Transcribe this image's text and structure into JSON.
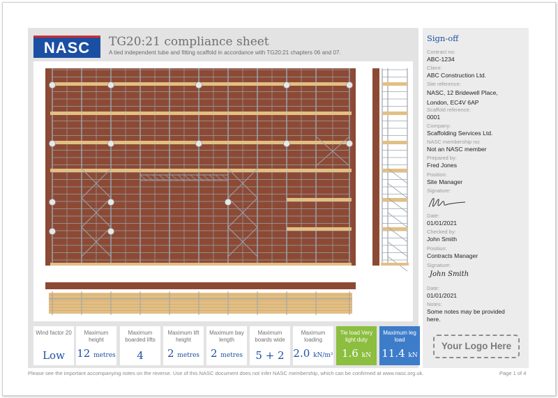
{
  "header": {
    "logo_text": "NASC",
    "title": "TG20:21 compliance sheet",
    "subtitle": "A tied independent tube and fitting scaffold in accordance with TG20:21 chapters 06 and 07."
  },
  "tiles": [
    {
      "label": "Wind factor 20",
      "value": "Low",
      "unit": "",
      "style": "green"
    },
    {
      "label": "Maximum height",
      "value": "12",
      "unit": "metres",
      "style": "white"
    },
    {
      "label": "Maximum boarded lifts",
      "value": "4",
      "unit": "",
      "style": "white"
    },
    {
      "label": "Maximum lift height",
      "value": "2",
      "unit": "metres",
      "style": "white"
    },
    {
      "label": "Maximum bay length",
      "value": "2",
      "unit": "metres",
      "style": "white"
    },
    {
      "label": "Maximum boards wide",
      "value": "5 + 2",
      "unit": "",
      "style": "white"
    },
    {
      "label": "Maximum loading",
      "value": "2.0",
      "unit": "kN/m²",
      "style": "white"
    },
    {
      "label": "Tie load Very light duty",
      "value": "1.6",
      "unit": "kN",
      "style": "green"
    },
    {
      "label": "Maximum leg load",
      "value": "11.4",
      "unit": "kN",
      "style": "blue"
    }
  ],
  "signoff": {
    "heading": "Sign-off",
    "contract_no_label": "Contract no:",
    "contract_no": "ABC-1234",
    "client_label": "Client:",
    "client": "ABC Construction Ltd.",
    "site_label": "Site reference:",
    "site_line1": "NASC, 12 Bridewell Place,",
    "site_line2": "London, EC4V 6AP",
    "scaffold_label": "Scaffold reference:",
    "scaffold": "0001",
    "company_label": "Company:",
    "company": "Scaffolding Services Ltd.",
    "membership_label": "NASC membership no:",
    "membership": "Not an NASC member",
    "prepared_label": "Prepared by:",
    "prepared": "Fred Jones",
    "position1_label": "Position:",
    "position1": "Site Manager",
    "signature1_label": "Signature:",
    "date1_label": "Date:",
    "date1": "01/01/2021",
    "checked_label": "Checked by:",
    "checked": "John Smith",
    "position2_label": "Position:",
    "position2": "Contracts Manager",
    "signature2_label": "Signature:",
    "signature2_text": "John Smith",
    "date2_label": "Date:",
    "date2": "01/01/2021",
    "notes_label": "Notes:",
    "notes_line1": "Some notes may be provided",
    "notes_line2": "here.",
    "your_logo": "Your Logo Here"
  },
  "footer": {
    "note": "Please see the important accompanying notes on the reverse. Use of this NASC document does not infer NASC membership, which can be confirmed at www.nasc.org.uk.",
    "page": "Page 1 of 4"
  },
  "colors": {
    "brand_blue": "#1b4fa3",
    "brand_red": "#d22c2c",
    "brick": "#8c4a35",
    "board": "#e2bf84",
    "tube": "#9aa3ad",
    "tile_green": "#8cbe3f",
    "tile_blue": "#3d7cc9"
  }
}
